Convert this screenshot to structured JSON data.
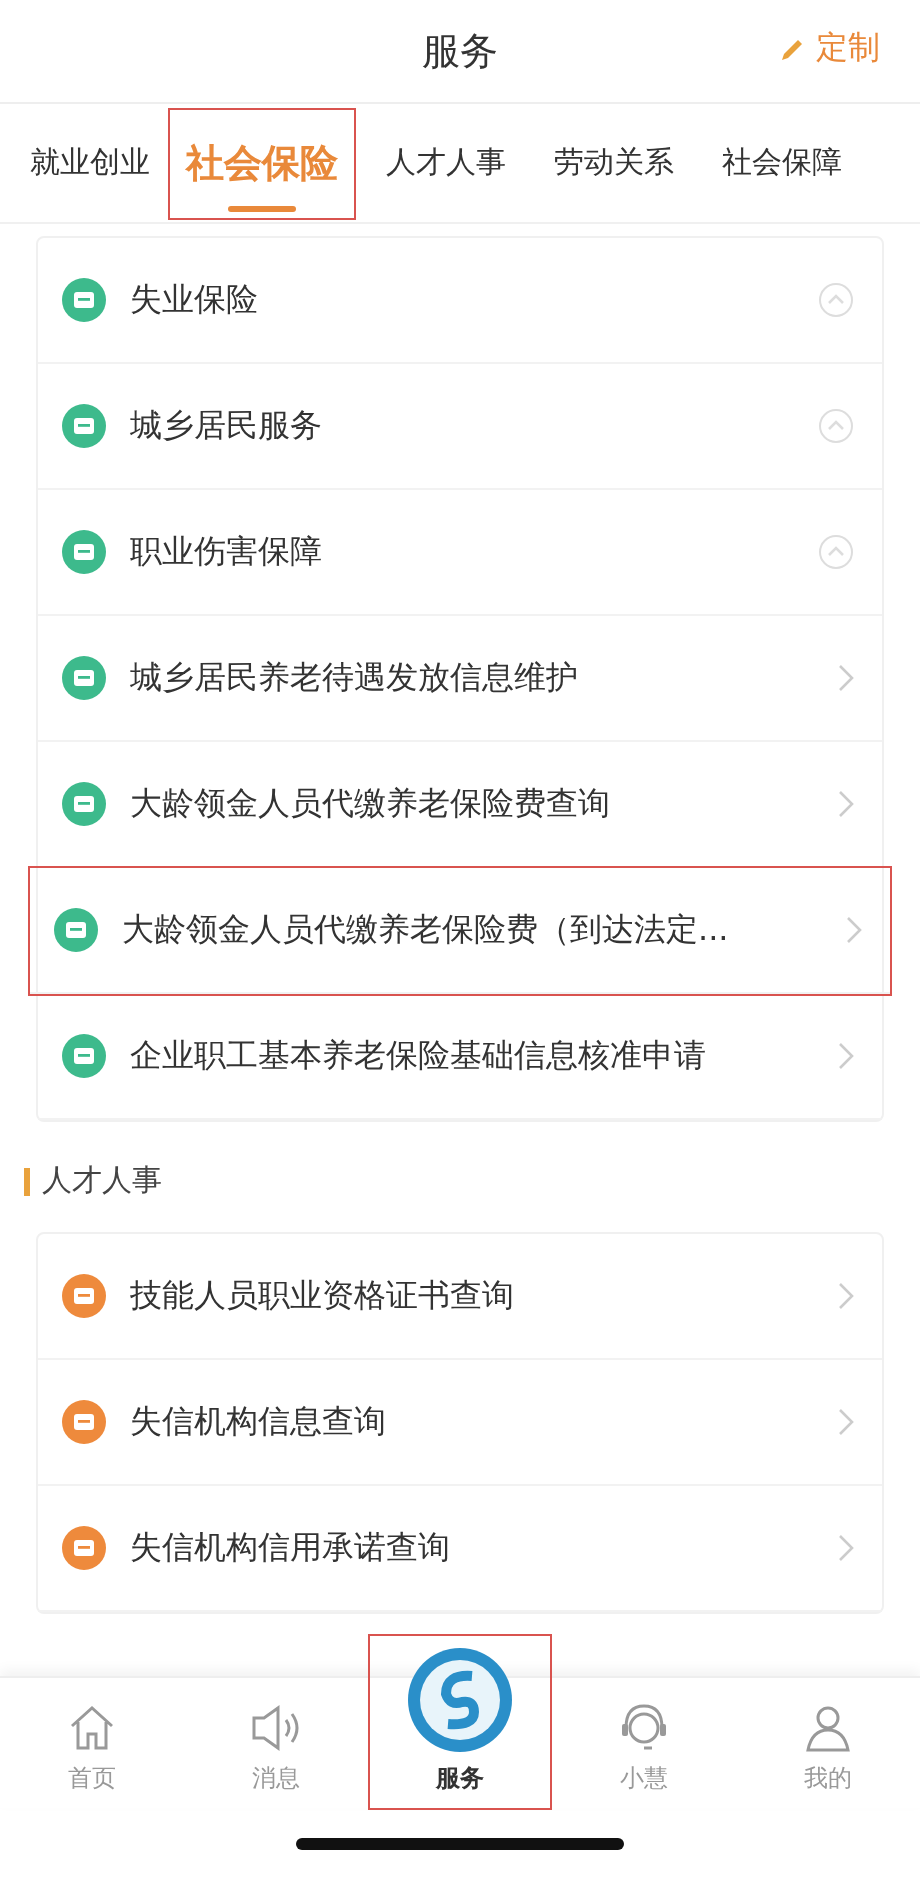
{
  "header": {
    "title": "服务",
    "action": "定制"
  },
  "tabs": [
    {
      "label": "就业创业",
      "selected": false,
      "highlighted": false
    },
    {
      "label": "社会保险",
      "selected": true,
      "highlighted": true
    },
    {
      "label": "人才人事",
      "selected": false,
      "highlighted": false
    },
    {
      "label": "劳动关系",
      "selected": false,
      "highlighted": false
    },
    {
      "label": "社会保障",
      "selected": false,
      "highlighted": false
    }
  ],
  "sections": [
    {
      "color": "#3dba8c",
      "items": [
        {
          "label": "失业保险",
          "kind": "group",
          "highlighted": false
        },
        {
          "label": "城乡居民服务",
          "kind": "group",
          "highlighted": false
        },
        {
          "label": "职业伤害保障",
          "kind": "group",
          "highlighted": false
        },
        {
          "label": "城乡居民养老待遇发放信息维护",
          "kind": "link",
          "highlighted": false
        },
        {
          "label": "大龄领金人员代缴养老保险费查询",
          "kind": "link",
          "highlighted": false
        },
        {
          "label": "大龄领金人员代缴养老保险费（到达法定...",
          "kind": "link",
          "highlighted": true
        },
        {
          "label": "企业职工基本养老保险基础信息核准申请",
          "kind": "link",
          "highlighted": false
        }
      ]
    },
    {
      "title": "人才人事",
      "color": "#ee8a3c",
      "items": [
        {
          "label": "技能人员职业资格证书查询",
          "kind": "link",
          "highlighted": false
        },
        {
          "label": "失信机构信息查询",
          "kind": "link",
          "highlighted": false
        },
        {
          "label": "失信机构信用承诺查询",
          "kind": "link",
          "highlighted": false
        }
      ]
    }
  ],
  "nav": [
    {
      "label": "首页",
      "kind": "home",
      "selected": false,
      "highlighted": false
    },
    {
      "label": "消息",
      "kind": "message",
      "selected": false,
      "highlighted": false
    },
    {
      "label": "服务",
      "kind": "service",
      "selected": true,
      "highlighted": true
    },
    {
      "label": "小慧",
      "kind": "assistant",
      "selected": false,
      "highlighted": false
    },
    {
      "label": "我的",
      "kind": "profile",
      "selected": false,
      "highlighted": false
    }
  ]
}
